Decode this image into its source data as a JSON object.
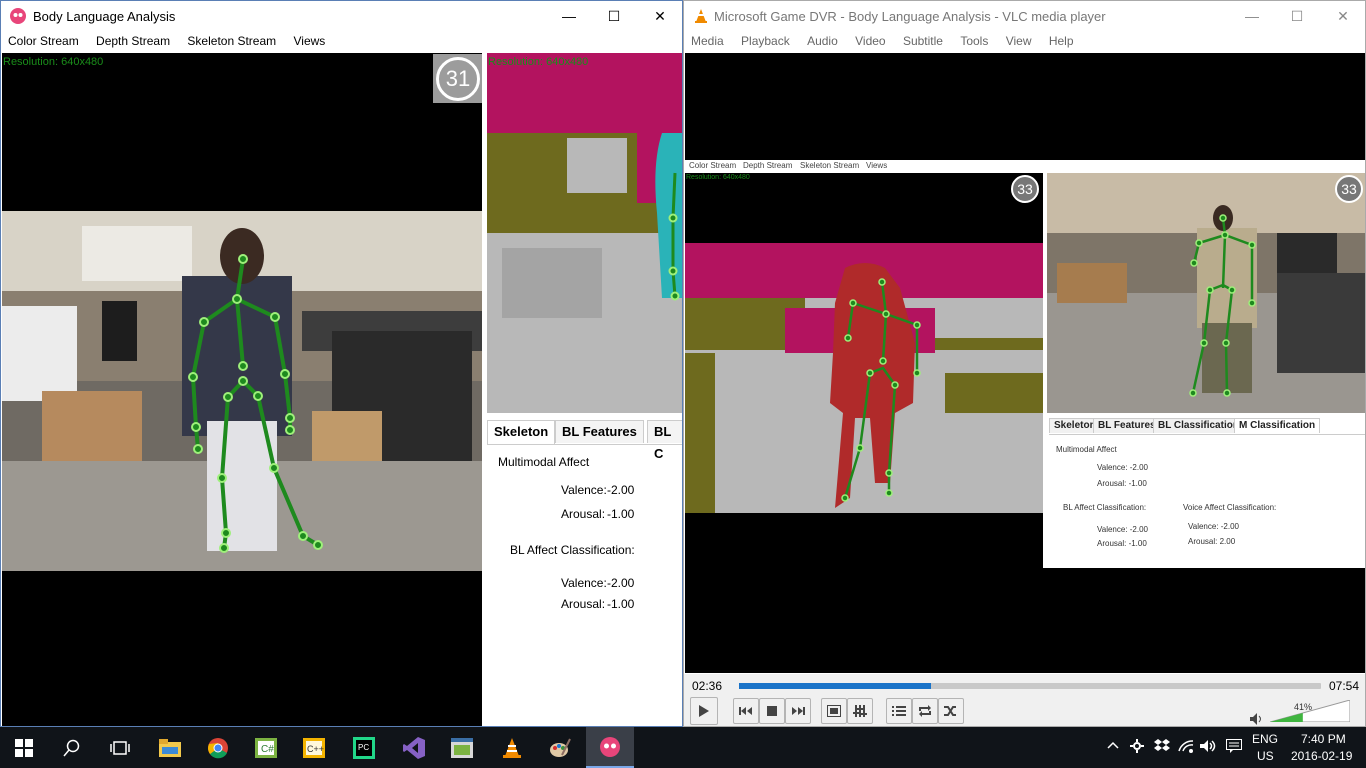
{
  "left_window": {
    "title": "Body Language Analysis",
    "menu": [
      "Color Stream",
      "Depth Stream",
      "Skeleton Stream",
      "Views"
    ],
    "color_resolution": "Resolution: 640x480",
    "depth_resolution": "Resolution: 640x480",
    "count_badge": "31",
    "tabs": [
      "Skeleton",
      "BL Features",
      "BL C"
    ],
    "multimodal_title": "Multimodal Affect",
    "valence_label": "Valence:",
    "valence_value": "-2.00",
    "arousal_label": "Arousal:",
    "arousal_value": "-1.00",
    "bl_title": "BL Affect Classification:",
    "bl_valence_label": "Valence:",
    "bl_valence_value": "-2.00",
    "bl_arousal_label": "Arousal:",
    "bl_arousal_value": "-1.00"
  },
  "vlc_window": {
    "title": "Microsoft Game DVR - Body Language Analysis - VLC media player",
    "menu": [
      "Media",
      "Playback",
      "Audio",
      "Video",
      "Subtitle",
      "Tools",
      "View",
      "Help"
    ],
    "time_current": "02:36",
    "time_total": "07:54",
    "progress": 0.33,
    "volume": "41%",
    "volume_level": 0.41,
    "video": {
      "menu": [
        "Color Stream",
        "Depth Stream",
        "Skeleton Stream",
        "Views"
      ],
      "depth_resolution": "Resolution: 640x480",
      "badge_left": "33",
      "badge_right": "33",
      "tabs": [
        "Skeleton",
        "BL Features",
        "BL Classification",
        "M Classification"
      ],
      "multimodal_title": "Multimodal Affect",
      "valence": "Valence: -2.00",
      "arousal": "Arousal: -1.00",
      "bl_title": "BL Affect Classification:",
      "bl_valence": "Valence: -2.00",
      "bl_arousal": "Arousal: -1.00",
      "voice_title": "Voice Affect Classification:",
      "voice_valence": "Valence: -2.00",
      "voice_arousal": "Arousal: 2.00"
    }
  },
  "taskbar": {
    "lang": "ENG",
    "region": "US",
    "time": "7:40 PM",
    "date": "2016-02-19"
  },
  "colors": {
    "skeleton_green": "#1e8a1e",
    "joint_green": "#9ef07a",
    "depth_magenta": "#b3135f",
    "depth_olive": "#6e6a1e",
    "depth_gray": "#b8b8b8",
    "depth_teal": "#2ab3b8",
    "vlc_progress": "#1a73c8"
  }
}
